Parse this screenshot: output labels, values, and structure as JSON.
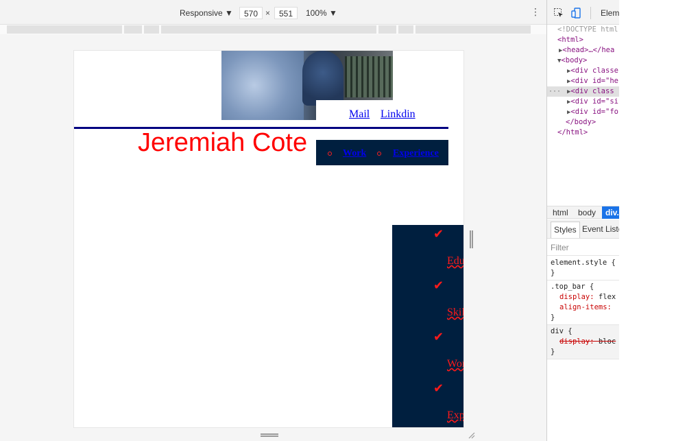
{
  "device_toolbar": {
    "mode": "Responsive ▼",
    "width": "570",
    "times": "×",
    "height": "551",
    "zoom": "100% ▼",
    "menu_icon": "⋮"
  },
  "page": {
    "top_links": {
      "mail": "Mail",
      "linkedin": "Linkdin"
    },
    "site_name": "Jeremiah Cote",
    "nav": {
      "work": "Work",
      "experience": "Experience"
    },
    "side_nav": [
      {
        "label": "Education"
      },
      {
        "label": "Skills"
      },
      {
        "label": "Work"
      },
      {
        "label": "Experience"
      }
    ],
    "check_glyph": "✔",
    "colors": {
      "accent_red": "#ff0000",
      "navy": "#001f3f",
      "rule_blue": "#000080",
      "link_blue": "#0000ee"
    }
  },
  "devtools": {
    "tab": "Elem",
    "dom": {
      "doctype": "<!DOCTYPE html",
      "html_open": "<html>",
      "head": "<head>…</hea",
      "body_open": "<body>",
      "div1": "<div classe",
      "div2": "<div id=\"he",
      "div3": "<div class",
      "div4": "<div id=\"si",
      "div5": "<div id=\"fo",
      "body_close": "</body>",
      "html_close": "</html>",
      "dots": "···"
    },
    "breadcrumbs": {
      "html": "html",
      "body": "body",
      "div": "div."
    },
    "style_tabs": {
      "styles": "Styles",
      "events": "Event Liste"
    },
    "filter": "Filter",
    "rules": {
      "element_style": "element.style {",
      "close": "}",
      "top_bar_selector": ".top_bar {",
      "display_prop": "display",
      "display_val": "flex",
      "align_prop": "align-items",
      "align_val": "",
      "div_selector": "div {",
      "div_display_prop": "display",
      "div_display_val": "bloc"
    }
  }
}
